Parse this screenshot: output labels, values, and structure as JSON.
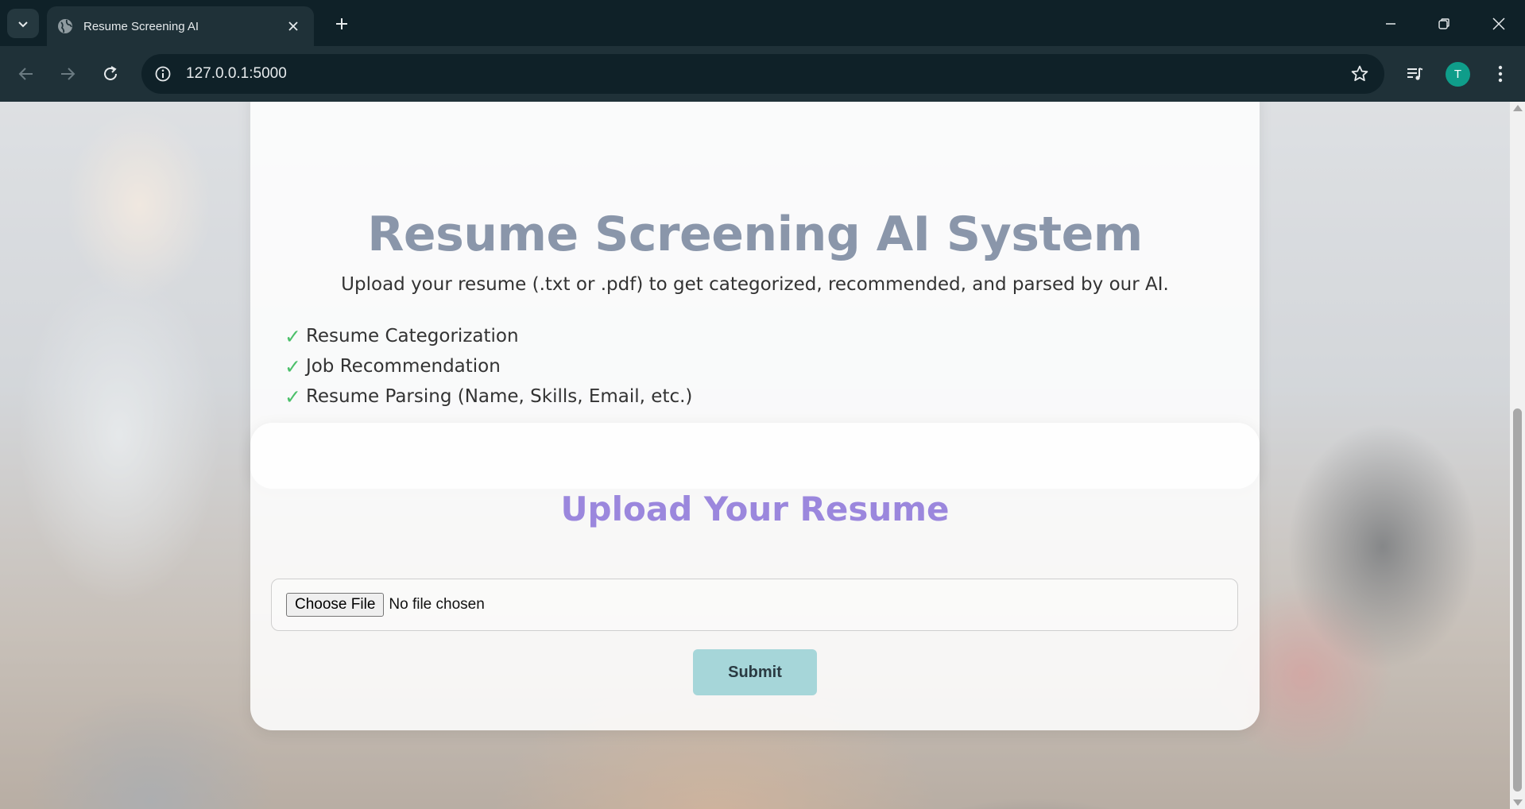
{
  "browser": {
    "tab": {
      "title": "Resume Screening AI",
      "icon": "globe-icon"
    },
    "address_bar": {
      "url": "127.0.0.1:5000"
    },
    "profile_initial": "T",
    "accent_color": "#0f9d8a"
  },
  "hero": {
    "title": "Resume Screening AI System",
    "subtitle": "Upload your resume (.txt or .pdf) to get categorized, recommended, and parsed by our AI.",
    "features": [
      {
        "check": "✓",
        "text": "Resume Categorization"
      },
      {
        "check": "✓",
        "text": "Job Recommendation"
      },
      {
        "check": "✓",
        "text": "Resume Parsing (Name, Skills, Email, etc.)"
      }
    ]
  },
  "upload": {
    "title": "Upload Your Resume",
    "choose_file_label": "Choose File",
    "file_status": "No file chosen",
    "submit_label": "Submit"
  },
  "colors": {
    "title": "#8a96aa",
    "upload_title": "#9b87dd",
    "check": "#4cc06a",
    "submit_bg": "#a6d6d9"
  }
}
